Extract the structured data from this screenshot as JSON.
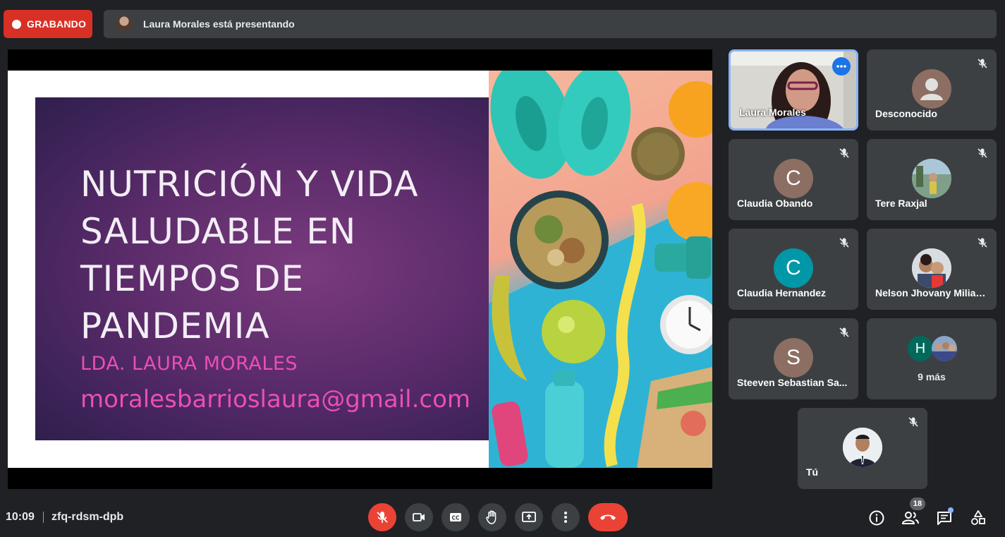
{
  "header": {
    "recording_label": "GRABANDO",
    "presenting_text": "Laura Morales está presentando"
  },
  "slide": {
    "title": "NUTRICIÓN Y VIDA SALUDABLE EN TIEMPOS DE PANDEMIA",
    "subtitle": "LDA. LAURA MORALES",
    "email": "moralesbarrioslaura@gmail.com"
  },
  "participants": [
    {
      "name": "Laura Morales",
      "type": "video",
      "muted": false
    },
    {
      "name": "Desconocido",
      "type": "placeholder",
      "muted": true
    },
    {
      "name": "Claudia Obando",
      "initial": "C",
      "color": "#8d6e63",
      "muted": true
    },
    {
      "name": "Tere Raxjal",
      "type": "photo",
      "muted": true
    },
    {
      "name": "Claudia Hernandez",
      "initial": "C",
      "color": "#0097a7",
      "muted": true
    },
    {
      "name": "Nelson Jhovany Milian...",
      "type": "photo",
      "muted": true
    },
    {
      "name": "Steeven Sebastian Sa...",
      "initial": "S",
      "color": "#8d6e63",
      "muted": true
    },
    {
      "name": "9 más",
      "initial": "H",
      "color": "#00695c",
      "type": "overflow"
    },
    {
      "name": "Tú",
      "type": "photo",
      "muted": true
    }
  ],
  "footer": {
    "time": "10:09",
    "meeting_code": "zfq-rdsm-dpb",
    "people_count": "18"
  },
  "colors": {
    "background": "#202124",
    "tile": "#3c4043",
    "recording": "#d93025",
    "end_call": "#ea4335",
    "active_border": "#8ab4f8",
    "slide_accent": "#ea4fb4"
  }
}
